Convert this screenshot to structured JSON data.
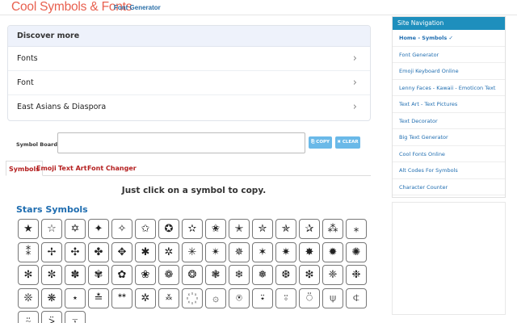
{
  "header": {
    "title": "Cool Symbols & Fonts",
    "subtitle": "Font Generator"
  },
  "discover": {
    "heading": "Discover more",
    "items": [
      "Fonts",
      "Font",
      "East Asians & Diaspora"
    ],
    "chevron": "›"
  },
  "symbol_board": {
    "label": "Symbol Board",
    "value": "",
    "copy_label": "⎘ COPY",
    "clear_label": "✖ CLEAR"
  },
  "tabs": [
    "Symbols",
    "Emoji",
    "Text Art",
    "Font Changer"
  ],
  "active_tab": "Symbols",
  "hint": "Just click on a symbol to copy.",
  "section_title": "Stars Symbols",
  "symbols": [
    [
      "★",
      "☆",
      "✡",
      "✦",
      "✧",
      "✩",
      "✪",
      "✫",
      "✬",
      "✭",
      "✮",
      "✯",
      "✰",
      "⁂",
      "⁎"
    ],
    [
      "⁑",
      "✢",
      "✣",
      "✤",
      "✥",
      "✱",
      "✲",
      "✳",
      "✴",
      "✵",
      "✶",
      "✷",
      "✸",
      "✹",
      "✺"
    ],
    [
      "✻",
      "✼",
      "✽",
      "✾",
      "✿",
      "❀",
      "❁",
      "❂",
      "❃",
      "❄",
      "❅",
      "❆",
      "❇",
      "❈",
      "❉"
    ],
    [
      "❊",
      "❋",
      "⋆",
      "≛",
      "ᕯ",
      "✲",
      "࿏",
      "꙰",
      "۞",
      "⍟",
      "⍣",
      "⍤",
      "⍥",
      "⍦",
      "⍧"
    ],
    [
      "⍨",
      "⍩",
      "⍪"
    ]
  ],
  "sidebar": {
    "heading": "Site Navigation",
    "items": [
      "Home - Symbols ✓",
      "Font Generator",
      "Emoji Keyboard Online",
      "Lenny Faces - Kawaii - Emoticon Text",
      "Text Art - Text Pictures",
      "Text Decorator",
      "Big Text Generator",
      "Cool Fonts Online",
      "Alt Codes For Symbols",
      "Character Counter"
    ]
  },
  "colors": {
    "title": "#e8604f",
    "link": "#1f6db0",
    "tab": "#b41e1e",
    "nav_header": "#1e8fbd",
    "button": "#6ab9e8"
  }
}
